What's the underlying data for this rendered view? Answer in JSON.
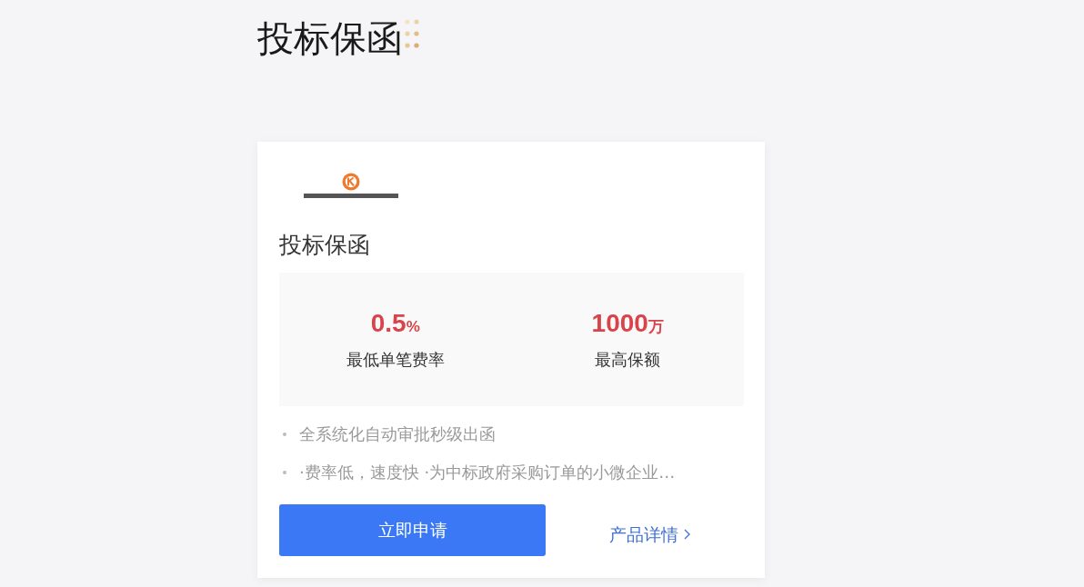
{
  "page_title": "投标保函",
  "product_card": {
    "card_title": "投标保函",
    "stats": [
      {
        "value": "0.5",
        "unit": "%",
        "label": "最低单笔费率"
      },
      {
        "value": "1000",
        "unit": "万",
        "label": "最高保额"
      }
    ],
    "features": [
      "全系统化自动审批秒级出函",
      "·费率低，速度快 ·为中标政府采购订单的小微企业…"
    ],
    "apply_button": "立即申请",
    "details_link": "产品详情"
  }
}
